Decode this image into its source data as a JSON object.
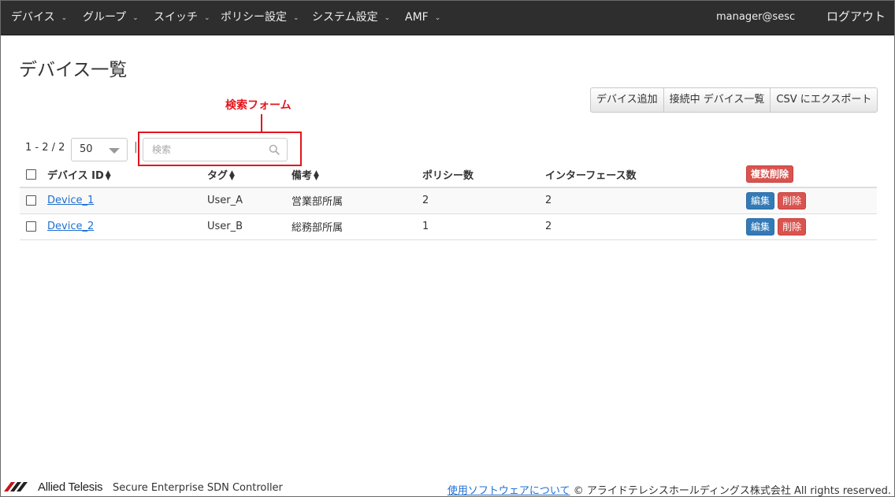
{
  "nav": {
    "items": [
      {
        "label": "デバイス"
      },
      {
        "label": "グループ"
      },
      {
        "label": "スイッチ"
      },
      {
        "label": "ポリシー設定"
      },
      {
        "label": "システム設定"
      },
      {
        "label": "AMF"
      }
    ],
    "user": "manager@sesc",
    "logout": "ログアウト"
  },
  "page": {
    "title": "デバイス一覧"
  },
  "toolbar": {
    "add_device": "デバイス追加",
    "connected_devices": "接続中 デバイス一覧",
    "export_csv": "CSV にエクスポート"
  },
  "annotation": {
    "label": "検索フォーム",
    "color": "#e5141b"
  },
  "list": {
    "count": "1 - 2 / 2",
    "per_page": "50",
    "separator": "|",
    "search_placeholder": "検索",
    "search_value": ""
  },
  "table": {
    "headers": {
      "device_id": "デバイス ID",
      "tag": "タグ",
      "note": "備考",
      "policy_count": "ポリシー数",
      "interface_count": "インターフェース数",
      "bulk_delete": "複数削除"
    },
    "rows": [
      {
        "device_id": "Device_1",
        "tag": "User_A",
        "note": "営業部所属",
        "policy_count": "2",
        "interface_count": "2",
        "edit": "編集",
        "delete": "削除"
      },
      {
        "device_id": "Device_2",
        "tag": "User_B",
        "note": "総務部所属",
        "policy_count": "1",
        "interface_count": "2",
        "edit": "編集",
        "delete": "削除"
      }
    ]
  },
  "footer": {
    "brand": "Allied Telesis",
    "product": "Secure Enterprise SDN Controller",
    "oss_link": "使用ソフトウェアについて",
    "copyright": "© アライドテレシスホールディングス株式会社 All rights reserved."
  },
  "colors": {
    "navbar_bg": "#2e2e2e",
    "link": "#1f6fd1",
    "primary": "#337ab7",
    "danger": "#d9534f"
  }
}
